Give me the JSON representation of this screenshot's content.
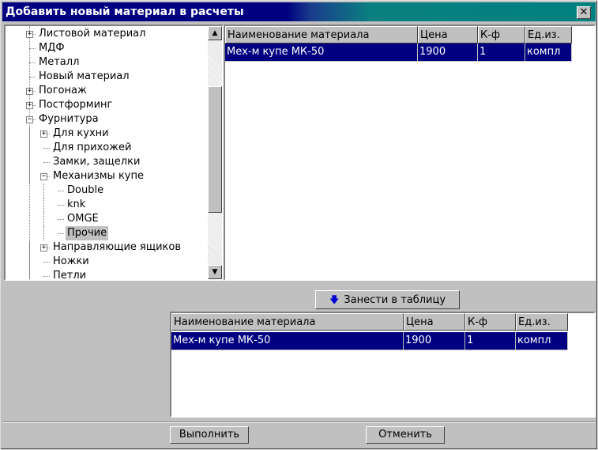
{
  "window": {
    "title": "Добавить новый материал в расчеты"
  },
  "tree": {
    "items": [
      {
        "label": "Листовой материал",
        "level": 0,
        "expander": "+"
      },
      {
        "label": "МДФ",
        "level": 0,
        "expander": ""
      },
      {
        "label": "Металл",
        "level": 0,
        "expander": ""
      },
      {
        "label": "Новый материал",
        "level": 0,
        "expander": ""
      },
      {
        "label": "Погонаж",
        "level": 0,
        "expander": "+"
      },
      {
        "label": "Постформинг",
        "level": 0,
        "expander": "+"
      },
      {
        "label": "Фурнитура",
        "level": 0,
        "expander": "-"
      },
      {
        "label": "Для кухни",
        "level": 1,
        "expander": "+"
      },
      {
        "label": "Для прихожей",
        "level": 1,
        "expander": ""
      },
      {
        "label": "Замки, защелки",
        "level": 1,
        "expander": ""
      },
      {
        "label": "Механизмы купе",
        "level": 1,
        "expander": "-"
      },
      {
        "label": "Double",
        "level": 2,
        "expander": ""
      },
      {
        "label": "knk",
        "level": 2,
        "expander": ""
      },
      {
        "label": "OMGE",
        "level": 2,
        "expander": ""
      },
      {
        "label": "Прочие",
        "level": 2,
        "expander": "",
        "selected": true
      },
      {
        "label": "Направляющие ящиков",
        "level": 1,
        "expander": "+"
      },
      {
        "label": "Ножки",
        "level": 1,
        "expander": ""
      },
      {
        "label": "Петли",
        "level": 1,
        "expander": ""
      }
    ]
  },
  "materials_grid": {
    "columns": [
      "Наименование материала",
      "Цена",
      "К-ф",
      "Ед.из."
    ],
    "rows": [
      [
        "Мех-м купе МК-50",
        "1900",
        "1",
        "компл"
      ]
    ]
  },
  "add_button": {
    "label": "Занести в таблицу"
  },
  "calc_grid": {
    "columns": [
      "Наименование материала",
      "Цена",
      "К-ф",
      "Ед.из."
    ],
    "rows": [
      [
        "Мех-м купе МК-50",
        "1900",
        "1",
        "компл"
      ]
    ]
  },
  "footer": {
    "ok_label": "Выполнить",
    "cancel_label": "Отменить"
  }
}
